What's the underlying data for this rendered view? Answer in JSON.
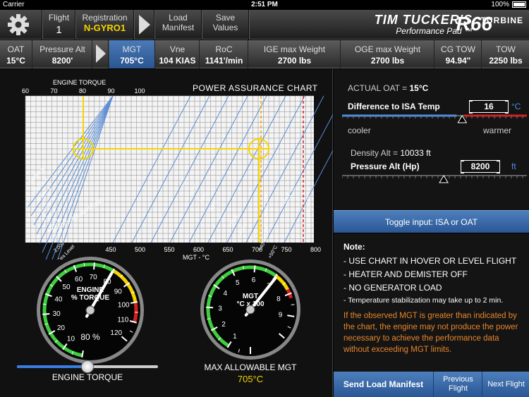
{
  "status": {
    "carrier": "Carrier",
    "time": "2:51 PM",
    "battery": "100%"
  },
  "toolbar": {
    "flight_label": "Flight",
    "flight_value": "1",
    "registration_label": "Registration",
    "registration_value": "N-GYRO1",
    "load_manifest": "Load Manifest",
    "save_values": "Save Values",
    "brand_line1": "TIM TUCKER'S",
    "brand_line2": "Performance Pad ™",
    "brand_model": "R66",
    "brand_suffix": "TURBINE"
  },
  "params": [
    {
      "label": "OAT",
      "value": "15°C"
    },
    {
      "label": "Pressure Alt",
      "value": "8200'"
    },
    {
      "label": "MGT",
      "value": "705°C"
    },
    {
      "label": "Vne",
      "value": "104 KIAS"
    },
    {
      "label": "RoC",
      "value": "1141'/min"
    },
    {
      "label": "IGE max Weight",
      "value": "2700 lbs"
    },
    {
      "label": "OGE max Weight",
      "value": "2700 lbs"
    },
    {
      "label": "CG TOW",
      "value": "94.94\""
    },
    {
      "label": "TOW",
      "value": "2250 lbs"
    }
  ],
  "chart": {
    "title": "POWER ASSURANCE CHART",
    "torque_label": "ENGINE TORQUE",
    "mgt_label": "MGT - °C",
    "torque_ticks": [
      "60",
      "70",
      "80",
      "90",
      "100"
    ],
    "mgt_ticks": [
      "450",
      "500",
      "550",
      "600",
      "650",
      "700",
      "750",
      "800"
    ],
    "alt_lines": [
      "16,000 ft",
      "14,000 ft",
      "12,000 ft",
      "10,000 ft",
      "8,000 ft",
      "6,000 ft",
      "4,000 ft",
      "2,000 ft",
      "Sea Level"
    ],
    "pressure_altitude": "PRESSURE ALTITUDE",
    "oat_lines": [
      "-40°C",
      "-30°C",
      "-20°C",
      "-10°C",
      "0°C",
      "+10°C",
      "+20°C",
      "+30°C",
      "+40°C",
      "+50°C"
    ],
    "oat_label": "OAT °C",
    "continuous_limit": "CONTINUOUS LIMIT",
    "five_min_limit": "5-MINUTE LIMIT"
  },
  "right": {
    "actual_oat_label": "ACTUAL OAT =",
    "actual_oat_value": "15°C",
    "isa_label": "Difference to ISA Temp",
    "isa_value": "16",
    "isa_unit": "°C",
    "cooler": "cooler",
    "warmer": "warmer",
    "density_label": "Density Alt =",
    "density_value": "10033 ft",
    "pa_label": "Pressure Alt (Hp)",
    "pa_value": "8200",
    "pa_unit": "ft",
    "isa_slider_fraction": 0.65,
    "pa_slider_fraction": 0.55
  },
  "toggle": "Toggle input: ISA or OAT",
  "notes": {
    "title": "Note:",
    "items": [
      "- USE CHART IN HOVER OR LEVEL FLIGHT",
      "- HEATER AND DEMISTER OFF",
      "- NO GENERATOR LOAD"
    ],
    "small": "- Temperature stabilization may take up to 2 min.",
    "warning": "If the observed MGT is greater than indicated by the chart, the engine may not produce the power necessary to achieve the performance data without exceeding MGT limits."
  },
  "bottom": {
    "send": "Send Load Manifest",
    "previous": "Previous Flight",
    "next": "Next Flight"
  },
  "torque_gauge": {
    "title_line1": "ENGINE",
    "title_line2": "% TORQUE",
    "ticks": [
      "10",
      "20",
      "30",
      "40",
      "50",
      "60",
      "70",
      "80",
      "90",
      "100",
      "110",
      "120"
    ],
    "value_text": "80 %",
    "value": 80
  },
  "mgt_gauge": {
    "title_line1": "MGT",
    "title_line2": "°C x 100",
    "ticks": [
      "1",
      "2",
      "3",
      "4",
      "5",
      "6",
      "7",
      "8",
      "9"
    ],
    "value": 7.05
  },
  "slider": {
    "label": "ENGINE TORQUE",
    "fraction": 0.5
  },
  "max_mgt": {
    "label": "MAX ALLOWABLE MGT",
    "value": "705°C"
  },
  "colors": {
    "accent_blue": "#3a6fb3",
    "yellow": "#f5d400",
    "orange": "#e8862a",
    "red": "#d42020",
    "grid_blue": "#5a8ed6"
  }
}
